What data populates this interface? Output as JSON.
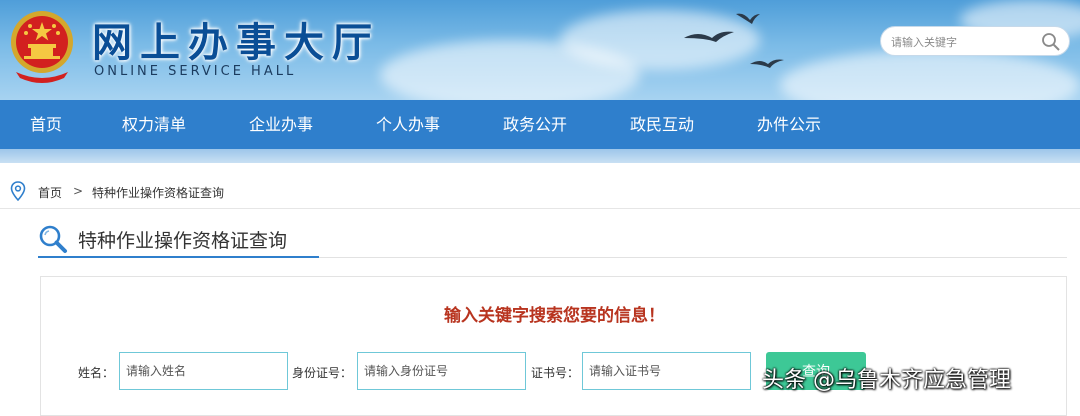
{
  "header": {
    "title": "网上办事大厅",
    "subtitle": "ONLINE SERVICE HALL",
    "search_placeholder": "请输入关键字"
  },
  "nav": {
    "items": [
      "首页",
      "权力清单",
      "企业办事",
      "个人办事",
      "政务公开",
      "政民互动",
      "办件公示"
    ]
  },
  "breadcrumb": {
    "home": "首页",
    "separator": ">",
    "current": "特种作业操作资格证查询"
  },
  "section": {
    "title": "特种作业操作资格证查询"
  },
  "query": {
    "prompt": "输入关键字搜索您要的信息！",
    "fields": [
      {
        "label": "姓名：",
        "placeholder": "请输入姓名"
      },
      {
        "label": "身份证号：",
        "placeholder": "请输入身份证号"
      },
      {
        "label": "证书号：",
        "placeholder": "请输入证书号"
      }
    ],
    "button_label": "查询"
  },
  "watermark": "头条 @乌鲁木齐应急管理",
  "colors": {
    "nav_bg": "#2f7fcc",
    "prompt_red": "#b8341f",
    "button_green": "#3dc896",
    "input_border": "#6fc8d8"
  },
  "icons": {
    "emblem": "national-emblem-icon",
    "search": "search-icon",
    "location": "location-pin-icon",
    "section": "magnifier-icon"
  }
}
